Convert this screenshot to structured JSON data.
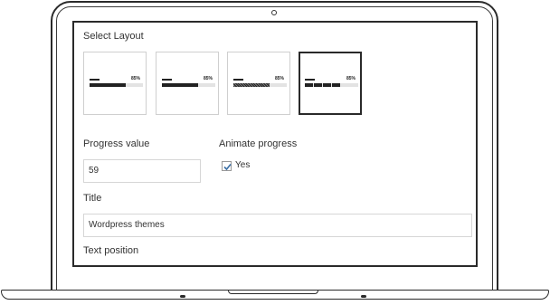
{
  "form": {
    "select_layout_label": "Select Layout",
    "layouts": [
      {
        "percent_label": "85%",
        "style": "solid"
      },
      {
        "percent_label": "85%",
        "style": "solid"
      },
      {
        "percent_label": "85%",
        "style": "striped"
      },
      {
        "percent_label": "85%",
        "style": "segmented",
        "selected": true
      }
    ],
    "progress_value_label": "Progress value",
    "progress_value": "59",
    "animate_label": "Animate progress",
    "animate_option_label": "Yes",
    "animate_checked": true,
    "title_label": "Title",
    "title_value": "Wordpress themes",
    "text_position_label": "Text position"
  }
}
